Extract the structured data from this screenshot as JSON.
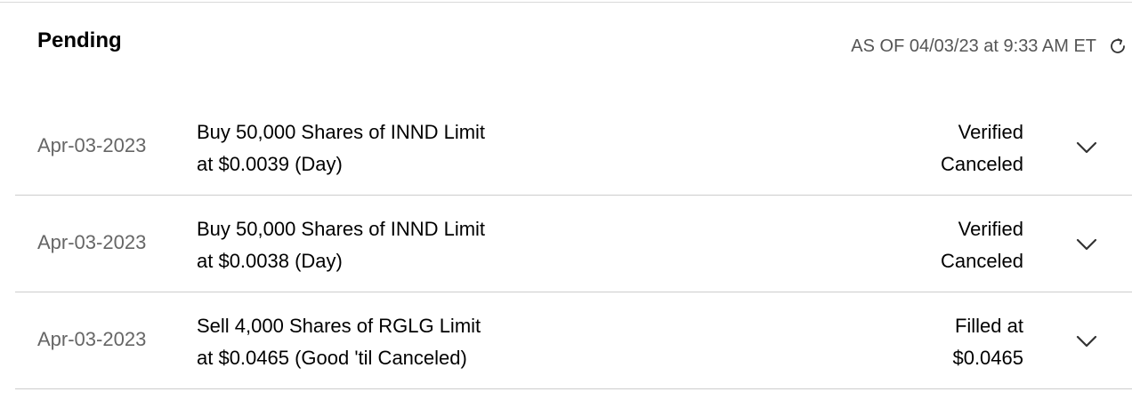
{
  "header": {
    "title": "Pending",
    "as_of": "AS OF 04/03/23 at 9:33 AM ET",
    "refresh_icon": "refresh-icon"
  },
  "orders": [
    {
      "date": "Apr-03-2023",
      "description_line1": "Buy 50,000 Shares of INND Limit",
      "description_line2": "at $0.0039 (Day)",
      "status_line1": "Verified",
      "status_line2": "Canceled",
      "expand_icon": "chevron-down-icon"
    },
    {
      "date": "Apr-03-2023",
      "description_line1": "Buy 50,000 Shares of INND Limit",
      "description_line2": "at $0.0038 (Day)",
      "status_line1": "Verified",
      "status_line2": "Canceled",
      "expand_icon": "chevron-down-icon"
    },
    {
      "date": "Apr-03-2023",
      "description_line1": "Sell 4,000 Shares of RGLG Limit",
      "description_line2": "at $0.0465 (Good 'til Canceled)",
      "status_line1": "Filled at",
      "status_line2": "$0.0465",
      "expand_icon": "chevron-down-icon"
    }
  ],
  "colors": {
    "text": "#000000",
    "muted_text": "#666666",
    "as_of_text": "#555555",
    "divider": "#cccccc"
  }
}
